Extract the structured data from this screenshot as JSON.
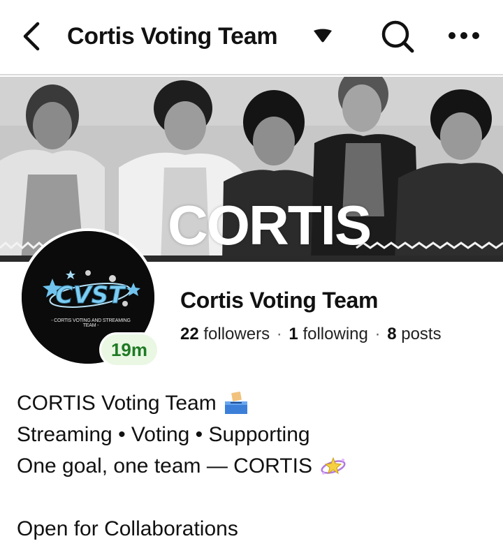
{
  "header": {
    "title": "Cortis Voting Team",
    "icons": [
      "back-arrow-icon",
      "caret-down-icon",
      "search-icon",
      "more-dots-icon"
    ]
  },
  "cover": {
    "overlay_text": "CORTIS"
  },
  "profile": {
    "avatar_logo_text": "CVST",
    "avatar_caption": "- CORTIS VOTING AND STREAMING TEAM -",
    "time_badge": "19m",
    "name": "Cortis Voting Team",
    "followers_count": "22",
    "followers_label": "followers",
    "following_count": "1",
    "following_label": "following",
    "posts_count": "8",
    "posts_label": "posts",
    "separator": "·"
  },
  "bio": {
    "line1": "CORTIS Voting Team",
    "line2": "Streaming • Voting • Supporting",
    "line3": "One goal, one team — CORTIS",
    "line5": "Open for Collaborations",
    "emojis": [
      "ballot-box-icon",
      "sparkle-planet-icon"
    ]
  },
  "colors": {
    "badge_bg": "#e9f7e3",
    "badge_text": "#1f7a23",
    "divider": "#d9d9d9",
    "avatar_bg": "#0b0b0b",
    "logo_blue": "#6fc3ee"
  }
}
